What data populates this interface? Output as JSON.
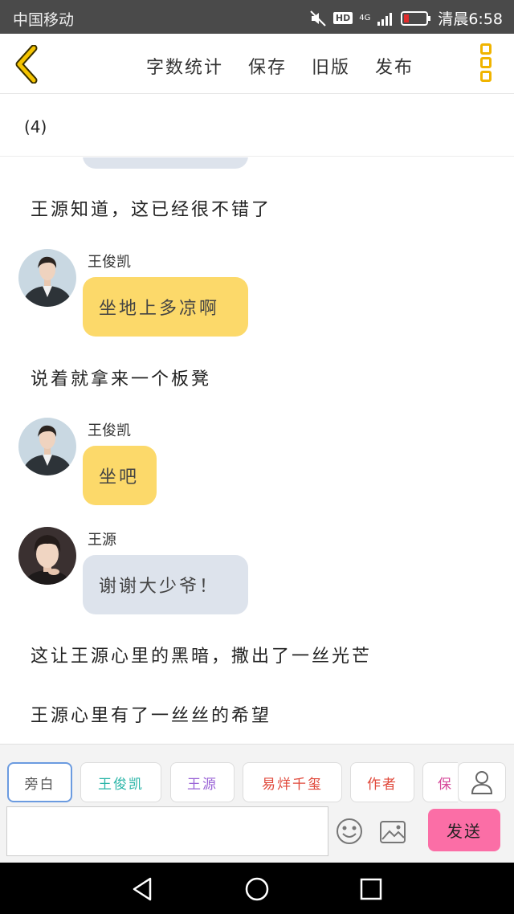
{
  "status_bar": {
    "carrier": "中国移动",
    "hd": "HD",
    "network": "4G",
    "time": "清晨6:58"
  },
  "nav": {
    "actions": [
      "字数统计",
      "保存",
      "旧版",
      "发布"
    ]
  },
  "chapter": {
    "title": "(4)"
  },
  "story": {
    "narration_1": "王源知道，这已经很不错了",
    "msg_1": {
      "speaker": "王俊凯",
      "text": "坐地上多凉啊"
    },
    "narration_2": "说着就拿来一个板凳",
    "msg_2": {
      "speaker": "王俊凯",
      "text": "坐吧"
    },
    "msg_3": {
      "speaker": "王源",
      "text": "谢谢大少爷！"
    },
    "narration_3": "这让王源心里的黑暗，撒出了一丝光芒",
    "narration_4": "王源心里有了一丝丝的希望"
  },
  "roles": [
    {
      "label": "旁白",
      "color": "#555555"
    },
    {
      "label": "王俊凯",
      "color": "#2bb5a8"
    },
    {
      "label": "王源",
      "color": "#9a63d6"
    },
    {
      "label": "易烊千玺",
      "color": "#e0483a"
    },
    {
      "label": "作者",
      "color": "#e0483a"
    },
    {
      "label": "保",
      "color": "#d6489a"
    }
  ],
  "input": {
    "value": "",
    "send_label": "发送"
  },
  "colors": {
    "accent_yellow": "#fcd96a",
    "bubble_grey": "#dde3ec",
    "send_pink": "#fb6ea6",
    "back_yellow": "#f0b400"
  }
}
